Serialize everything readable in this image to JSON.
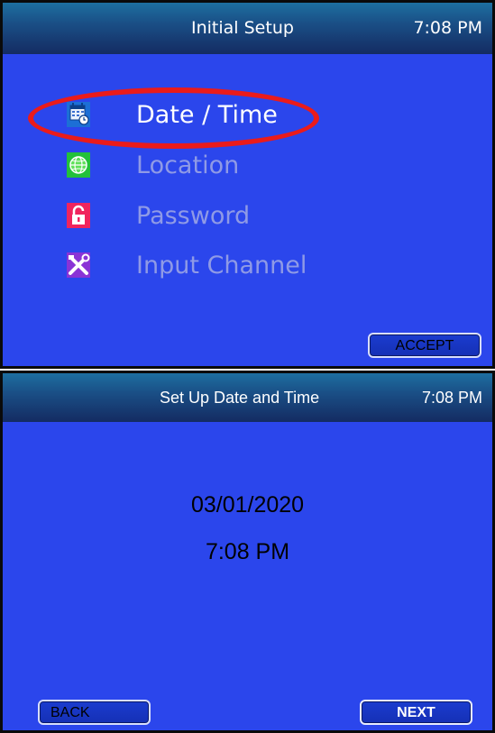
{
  "initial_setup": {
    "title": "Initial Setup",
    "clock": "7:08 PM",
    "menu": [
      {
        "label": "Date / Time",
        "icon": "calendar-clock-icon",
        "state": "active"
      },
      {
        "label": "Location",
        "icon": "globe-icon",
        "state": "inactive"
      },
      {
        "label": "Password",
        "icon": "padlock-icon",
        "state": "inactive"
      },
      {
        "label": "Input Channel",
        "icon": "tools-icon",
        "state": "inactive"
      }
    ],
    "accept_label": "ACCEPT",
    "highlight_color": "#ea1b1b"
  },
  "date_time_setup": {
    "title": "Set Up Date and Time",
    "clock": "7:08 PM",
    "date": "03/01/2020",
    "time": "7:08 PM",
    "back_label": "BACK",
    "next_label": "NEXT"
  },
  "colors": {
    "screen_background": "#2b46ec",
    "title_bar": "#1a4f86",
    "active_text": "#ffffff",
    "inactive_text": "#8f9ae6"
  }
}
